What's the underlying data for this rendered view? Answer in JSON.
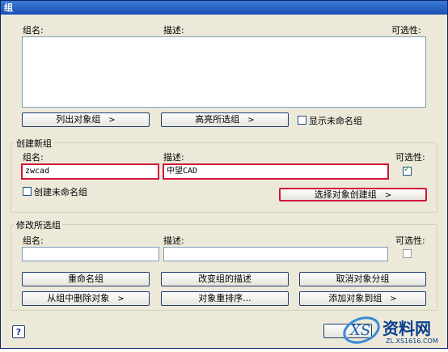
{
  "window": {
    "title": "组"
  },
  "top": {
    "col_name": "组名:",
    "col_desc": "描述:",
    "col_sel": "可选性:",
    "list_btn": "列出对象组",
    "highlight_btn": "高亮所选组",
    "show_unnamed": "显示未命名组",
    "btn_arrow": ">"
  },
  "create": {
    "group_title": "创建新组",
    "name_label": "组名:",
    "desc_label": "描述:",
    "sel_label": "可选性:",
    "name_value": "zwcad",
    "desc_value": "中望CAD",
    "unnamed_label": "创建未命名组",
    "select_btn": "选择对象创建组",
    "btn_arrow": ">"
  },
  "modify": {
    "group_title": "修改所选组",
    "name_label": "组名:",
    "desc_label": "描述:",
    "sel_label": "可选性:",
    "rename_btn": "重命名组",
    "change_desc_btn": "改变组的描述",
    "ungroup_btn": "取消对象分组",
    "remove_btn": "从组中删除对象",
    "reorder_btn": "对象重排序...",
    "add_btn": "添加对象到组",
    "btn_arrow": ">"
  },
  "footer": {
    "help": "?"
  },
  "watermark": {
    "text": "资料网",
    "url": "ZL.XS1616.COM"
  }
}
